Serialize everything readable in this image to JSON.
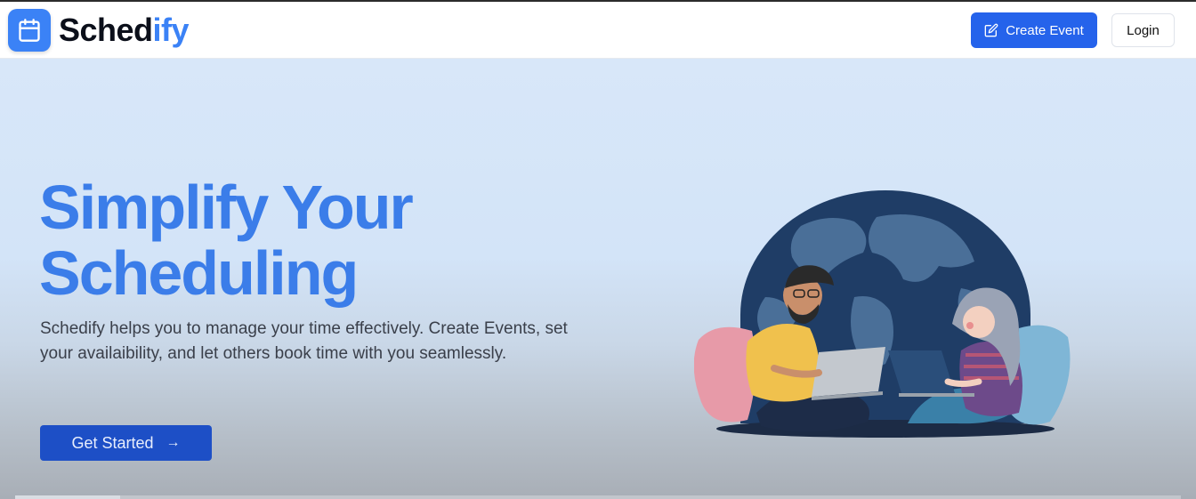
{
  "brand": {
    "name_main": "Sched",
    "name_accent": "ify",
    "icon": "calendar-icon",
    "accent_color": "#3b82f6"
  },
  "header": {
    "create_event_label": "Create Event",
    "create_event_icon": "edit-icon",
    "login_label": "Login",
    "primary_color": "#2563eb"
  },
  "hero": {
    "title_line1": "Simplify Your",
    "title_line2": "Scheduling",
    "description": "Schedify helps you to manage your time effectively. Create Events, set your availaibility, and let others book time with you seamlessly.",
    "cta_label": "Get Started",
    "cta_icon": "arrow-right-icon",
    "illustration": "two people with laptops in front of a globe"
  }
}
